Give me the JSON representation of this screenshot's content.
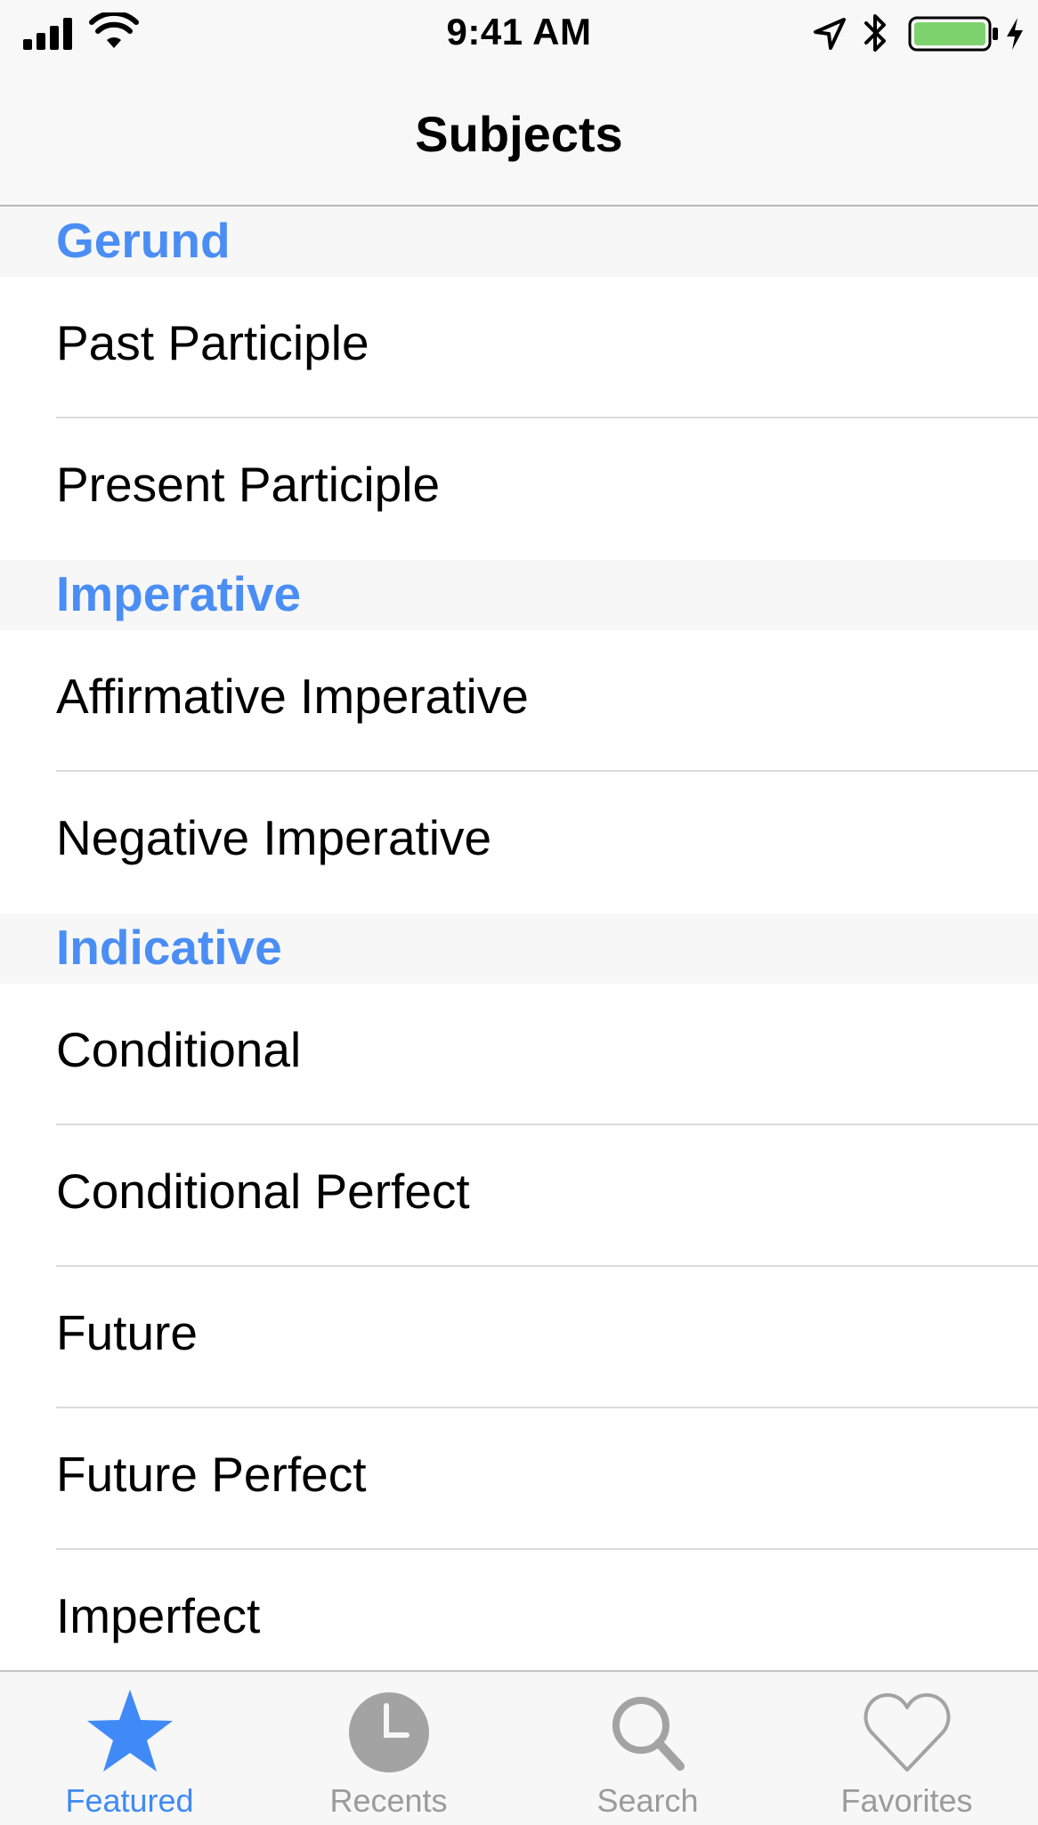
{
  "status_bar": {
    "time": "9:41 AM"
  },
  "nav": {
    "title": "Subjects"
  },
  "sections": [
    {
      "header": "Gerund",
      "items": [
        "Past Participle",
        "Present Participle"
      ]
    },
    {
      "header": "Imperative",
      "items": [
        "Affirmative Imperative",
        "Negative Imperative"
      ]
    },
    {
      "header": "Indicative",
      "items": [
        "Conditional",
        "Conditional Perfect",
        "Future",
        "Future Perfect",
        "Imperfect"
      ]
    }
  ],
  "tab_bar": {
    "tabs": [
      {
        "label": "Featured",
        "icon": "star-icon",
        "active": true
      },
      {
        "label": "Recents",
        "icon": "clock-icon",
        "active": false
      },
      {
        "label": "Search",
        "icon": "search-icon",
        "active": false
      },
      {
        "label": "Favorites",
        "icon": "heart-icon",
        "active": false
      }
    ]
  },
  "colors": {
    "accent": "#4a8ef5",
    "inactive": "#9b9b9b",
    "battery": "#4cd964"
  }
}
